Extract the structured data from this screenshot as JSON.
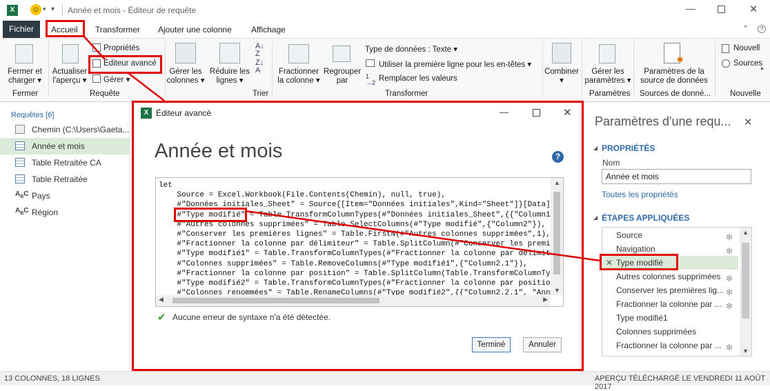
{
  "window": {
    "title": "Année et mois - Éditeur de requête"
  },
  "tabs": [
    "Fichier",
    "Accueil",
    "Transformer",
    "Ajouter une colonne",
    "Affichage"
  ],
  "ribbon": {
    "fermer_charger": [
      "Fermer et",
      "charger ▾"
    ],
    "actualiser": [
      "Actualiser",
      "l'aperçu ▾"
    ],
    "proprietes": "Propriétés",
    "editeur_avance": "Éditeur avancé",
    "gerer": "Gérer ▾",
    "gerer_colonnes": [
      "Gérer les",
      "colonnes ▾"
    ],
    "reduire_lignes": [
      "Réduire les",
      "lignes ▾"
    ],
    "fractionner": [
      "Fractionner",
      "la colonne ▾"
    ],
    "regrouper": [
      "Regrouper",
      "par"
    ],
    "type_donnees": "Type de données : Texte ▾",
    "premiere_ligne": "Utiliser la première ligne pour les en-têtes ▾",
    "remplacer": "Remplacer les valeurs",
    "combiner": [
      "Combiner",
      "▾"
    ],
    "gerer_parametres": [
      "Gérer les",
      "paramètres ▾"
    ],
    "parametres_source": [
      "Paramètres de la",
      "source de données"
    ],
    "nouvelle": "Nouvell",
    "sources": "Sources",
    "groups": {
      "fermer": "Fermer",
      "requete": "Requête",
      "trier": "Trier",
      "transformer": "Transformer",
      "parametres": "Paramètres",
      "sources": "Sources de donné...",
      "nouvelle": "Nouvelle"
    }
  },
  "left": {
    "header": "Requêtes [6]",
    "items": [
      "Chemin (C:\\Users\\Gaeta...",
      "Année et mois",
      "Table Retraitée CA",
      "Table Retraitée",
      "Pays",
      "Région"
    ]
  },
  "right": {
    "title": "Paramètres d'une requ...",
    "close": "✕",
    "proprietes": "PROPRIÉTÉS",
    "nom_label": "Nom",
    "nom_value": "Année et mois",
    "toutes": "Toutes les propriétés",
    "etapes": "ÉTAPES APPLIQUÉES",
    "steps": [
      "Source",
      "Navigation",
      "Type modifié",
      "Autres colonnes supprimées",
      "Conserver les premières lig...",
      "Fractionner la colonne par ...",
      "Type modifié1",
      "Colonnes supprimées",
      "Fractionner la colonne par ..."
    ]
  },
  "dialog": {
    "title": "Éditeur avancé",
    "heading": "Année et mois",
    "help": "?",
    "code": [
      "let",
      "    Source = Excel.Workbook(File.Contents(Chemin), null, true),",
      "    #\"Données initiales_Sheet\" = Source{[Item=\"Données initiales\",Kind=\"Sheet\"]}[Data]",
      "    #\"Type modifié\" = Table.TransformColumnTypes(#\"Données initiales_Sheet\",{{\"Column1",
      "    #\"Autres colonnes supprimées\" = Table.SelectColumns(#\"Type modifié\",{\"Column2\"}),",
      "    #\"Conserver les premières lignes\" = Table.FirstN(#\"Autres colonnes supprimées\",1),",
      "    #\"Fractionner la colonne par délimiteur\" = Table.SplitColumn(#\"Conserver les premiè",
      "    #\"Type modifié1\" = Table.TransformColumnTypes(#\"Fractionner la colonne par délimit",
      "    #\"Colonnes supprimées\" = Table.RemoveColumns(#\"Type modifié1\",{\"Column2.1\"}),",
      "    #\"Fractionner la colonne par position\" = Table.SplitColumn(Table.TransformColumnTy",
      "    #\"Type modifié2\" = Table.TransformColumnTypes(#\"Fractionner la colonne par positio",
      "    #\"Colonnes renommées\" = Table.RenameColumns(#\"Type modifié2\",{{\"Column2.2.1\", \"Anné"
    ],
    "status": "Aucune erreur de syntaxe n'a été détectée.",
    "ok": "Terminé",
    "cancel": "Annuler"
  },
  "statusbar": {
    "left": "13 COLONNES, 18 LIGNES",
    "right": "APERÇU TÉLÉCHARGÉ LE VENDREDI 11 AOÛT 2017"
  },
  "colors": {
    "red": "#e00000",
    "excel": "#1e7145",
    "selected": "#dcebd9",
    "fichier": "#2e3b45"
  }
}
